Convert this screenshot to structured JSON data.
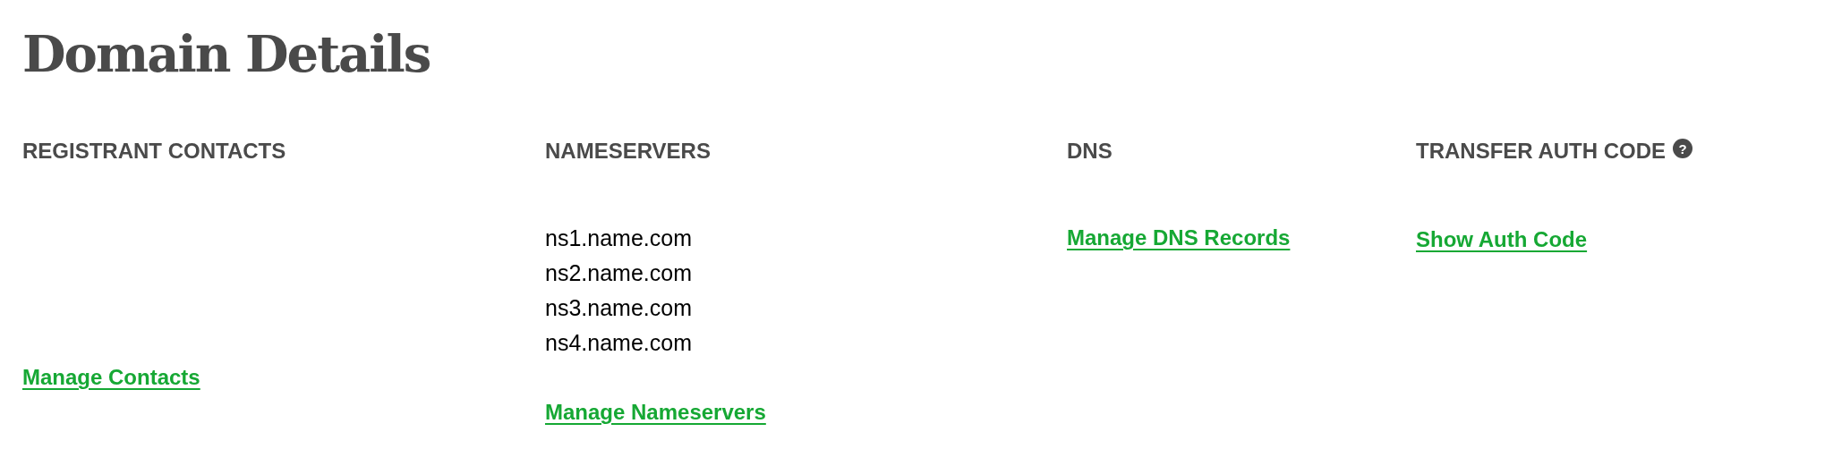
{
  "title": "Domain Details",
  "sections": [
    {
      "kind": "contacts",
      "heading": "REGISTRANT CONTACTS",
      "link": "Manage Contacts"
    },
    {
      "kind": "nameservers",
      "heading": "NAMESERVERS",
      "items": [
        "ns1.name.com",
        "ns2.name.com",
        "ns3.name.com",
        "ns4.name.com"
      ],
      "link": "Manage Nameservers"
    },
    {
      "kind": "dns",
      "heading": "DNS",
      "link": "Manage DNS Records"
    },
    {
      "kind": "auth",
      "heading": "TRANSFER AUTH CODE",
      "help": "?",
      "link": "Show Auth Code"
    }
  ]
}
